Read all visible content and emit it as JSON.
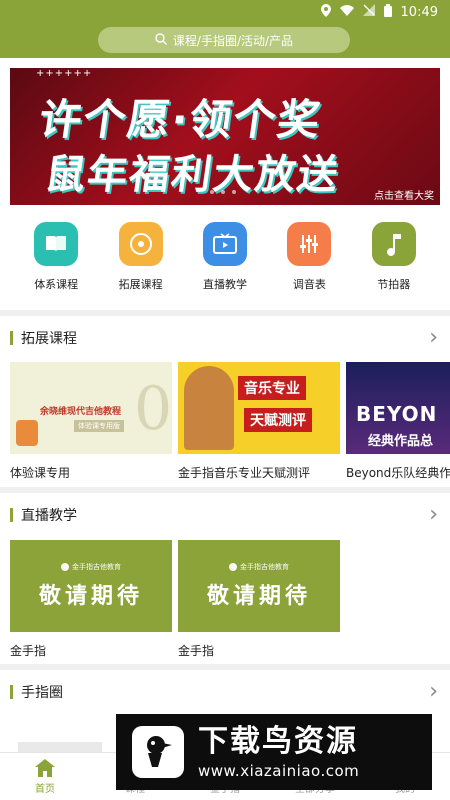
{
  "status_bar": {
    "time": "10:49"
  },
  "search": {
    "placeholder": "课程/手指圈/活动/产品"
  },
  "banner": {
    "stars": "++++++",
    "line1": "许个愿·领个奖",
    "line2": "鼠年福利大放送",
    "cta": "点击查看大奖"
  },
  "quick_menu": [
    {
      "label": "体系课程",
      "icon": "book-icon",
      "color": "#2bbfb2"
    },
    {
      "label": "拓展课程",
      "icon": "disc-icon",
      "color": "#f5b23c"
    },
    {
      "label": "直播教学",
      "icon": "tv-icon",
      "color": "#3d8fe6"
    },
    {
      "label": "调音表",
      "icon": "equalizer-icon",
      "color": "#f47d4a"
    },
    {
      "label": "节拍器",
      "icon": "music-note-icon",
      "color": "#8aa43a"
    }
  ],
  "sections": {
    "extend": {
      "title": "拓展课程",
      "cards": [
        {
          "caption": "体验课专用",
          "thumb_title": "余晓维现代吉他教程",
          "thumb_sub": "体验课专用版",
          "thumb_number": "0"
        },
        {
          "caption": "金手指音乐专业天赋测评",
          "thumb_line1": "音乐专业",
          "thumb_line2": "天赋测评"
        },
        {
          "caption": "Beyond乐队经典作",
          "thumb_line1": "BEYON",
          "thumb_line2": "经典作品总"
        }
      ]
    },
    "live": {
      "title": "直播教学",
      "cards": [
        {
          "caption": "金手指",
          "thumb_small": "金手指吉他教育",
          "thumb_big": "敬请期待"
        },
        {
          "caption": "金手指",
          "thumb_small": "金手指吉他教育",
          "thumb_big": "敬请期待"
        }
      ]
    },
    "circle": {
      "title": "手指圈"
    }
  },
  "bottom_nav": [
    {
      "label": "首页",
      "active": true
    },
    {
      "label": "课程",
      "active": false
    },
    {
      "label": "金手指",
      "active": false
    },
    {
      "label": "全部分享",
      "active": false
    },
    {
      "label": "我的",
      "active": false
    }
  ],
  "watermark": {
    "title": "下载鸟资源",
    "url": "www.xiazainiao.com"
  }
}
